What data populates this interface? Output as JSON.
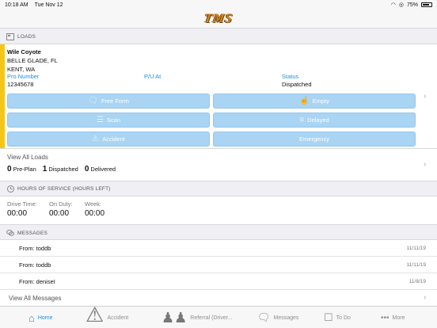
{
  "status_bar": {
    "time": "10:18 AM",
    "date": "Tue Nov 12",
    "battery": "75%",
    "wifi_icon": "wifi-icon",
    "location_icon": "location-icon",
    "battery_icon": "battery-icon"
  },
  "nav": {
    "logo": "TMS"
  },
  "loads_section": {
    "title": "LOADS",
    "icon": "loads-icon",
    "accent_color": "#f5c518",
    "driver_name": "Wile Coyote",
    "origin": "BELLE GLADE, FL",
    "destination": "KENT, WA",
    "pro_number_label": "Pro Number",
    "pro_number_value": "12345678",
    "pu_at_label": "P/U At",
    "pu_at_value": "",
    "status_label": "Status",
    "status_value": "Dispatched",
    "buttons": [
      {
        "label": "Free Form",
        "icon": "chat-bubbles-icon"
      },
      {
        "label": "Empty",
        "icon": "thumbs-up-icon"
      },
      {
        "label": "Scan",
        "icon": "document-scan-icon"
      },
      {
        "label": "Delayed",
        "icon": "list-icon"
      },
      {
        "label": "Accident",
        "icon": "warning-icon"
      },
      {
        "label": "Emergency",
        "icon": ""
      }
    ],
    "button_color": "#a9d4f3"
  },
  "loads_summary": {
    "view_all": "View All Loads",
    "pre_plan_count": "0",
    "pre_plan_label": "Pre-Plan",
    "dispatched_count": "1",
    "dispatched_label": "Dispatched",
    "delivered_count": "0",
    "delivered_label": "Delivered"
  },
  "hos": {
    "title": "HOURS OF SERVICE (HOURS LEFT)",
    "icon": "clock-icon",
    "drive_label": "Drive Time:",
    "drive_value": "00:00",
    "duty_label": "On Duty:",
    "duty_value": "00:00",
    "week_label": "Week:",
    "week_value": "00:00"
  },
  "messages": {
    "title": "MESSAGES",
    "icon": "chat-bubbles-icon",
    "items": [
      {
        "from": "From: toddb",
        "date": "11/11/19"
      },
      {
        "from": "From: toddb",
        "date": "11/11/19"
      },
      {
        "from": "From: deniseI",
        "date": "11/8/19"
      }
    ],
    "view_all": "View All Messages"
  },
  "tabs": [
    {
      "label": "Home",
      "icon": "home-icon",
      "active": true
    },
    {
      "label": "Accident",
      "icon": "warning-icon"
    },
    {
      "label": "Referral (Driver...",
      "icon": "people-icon"
    },
    {
      "label": "Messages",
      "icon": "chat-bubbles-icon"
    },
    {
      "label": "To Do",
      "icon": "todo-icon"
    },
    {
      "label": "More",
      "icon": "more-icon"
    }
  ],
  "accent": "#1f8fe0"
}
